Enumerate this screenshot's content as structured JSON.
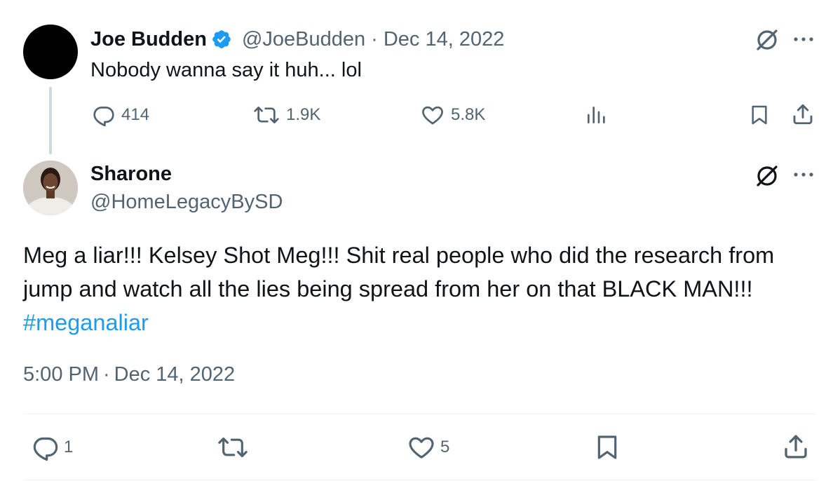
{
  "parent_tweet": {
    "author_name": "Joe Budden",
    "handle": "@JoeBudden",
    "separator": "·",
    "date": "Dec 14, 2022",
    "text": "Nobody wanna say it huh... lol",
    "stats": {
      "replies": "414",
      "reposts": "1.9K",
      "likes": "5.8K"
    },
    "icons": [
      "verified-badge-icon",
      "grok-icon",
      "more-icon",
      "reply-icon",
      "repost-icon",
      "like-icon",
      "views-icon",
      "bookmark-icon",
      "share-icon"
    ]
  },
  "main_tweet": {
    "author_name": "Sharone",
    "handle": "@HomeLegacyBySD",
    "text": "Meg a liar!!! Kelsey Shot Meg!!! Shit real people who did the research from jump and watch all the lies being spread from her on that BLACK MAN!!!",
    "hashtag": "#meganaliar",
    "time": "5:00 PM",
    "separator": "·",
    "date": "Dec 14, 2022",
    "stats": {
      "replies": "1",
      "likes": "5"
    },
    "icons": [
      "grok-icon",
      "more-icon",
      "reply-icon",
      "repost-icon",
      "like-icon",
      "bookmark-icon",
      "share-icon"
    ]
  },
  "colors": {
    "text": "#0f1419",
    "muted": "#536471",
    "link": "#1d9bf0",
    "verified": "#1d9bf0",
    "thread_line": "#cfd9de"
  }
}
